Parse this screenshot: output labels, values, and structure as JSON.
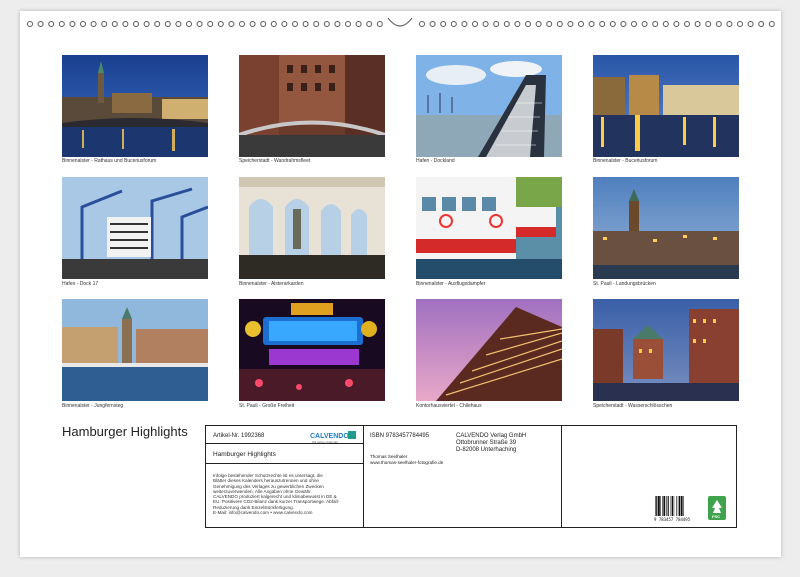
{
  "title": "Hamburger Highlights",
  "photos": [
    {
      "caption": "Binnenalster - Rathaus und Bucerius­forum"
    },
    {
      "caption": "Speicherstadt - Wandrahmsfleet"
    },
    {
      "caption": "Hafen - Dockland"
    },
    {
      "caption": "Binnenalster - Buceriusforum"
    },
    {
      "caption": "Hafen - Dock 17"
    },
    {
      "caption": "Binnenalster - Alsterarkarden"
    },
    {
      "caption": "Binnenalster - Ausflugsdampfer"
    },
    {
      "caption": "St. Pauli - Landungsbrücken"
    },
    {
      "caption": "Binnenalster - Jungfernsteg"
    },
    {
      "caption": "St. Pauli - Große Freiheit"
    },
    {
      "caption": "Kontorhausviertel - Chilehaus"
    },
    {
      "caption": "Speicherstadt - Wasserschlösschen"
    }
  ],
  "info": {
    "article_no": "Artikel-Nr. 1992368",
    "calvendo_logo": "CALVENDO",
    "calvendo_tagline": "Wir lieben Kalender",
    "product_title": "Hamburger Highlights",
    "legal_lines": [
      "Infolge bestehender Schutzrechte ist es untersagt, die",
      "Blätter dieses Kalenders herauszutrennen und ohne",
      "Genehmigung des Verlages zu gewerblichen Zwecken",
      "weiterzuverwenden. Alle Angaben ohne Gewähr.",
      "CALVENDO produziert kalgerecht und klimabewusst in DE &",
      "EU. Positivere CO2-Bilanz dank kurzer Transportwege. Abfall-",
      "Reduzierung dank Einzelstückfertigung.",
      "E-Mail: info@calvendo.com • www.calvendo.com"
    ],
    "isbn": "ISBN 9783457784495",
    "photographer": "Thomas Seelhaler",
    "photographer_url": "www.thomas-seelhaler-fotografie.de",
    "publisher_name": "CALVENDO Verlag GmbH",
    "publisher_street": "Ottobrunner Straße 39",
    "publisher_city": "D-82008 Unterhaching",
    "barcode_digits": "9 783457 784495",
    "fsc_label": "FSC"
  }
}
